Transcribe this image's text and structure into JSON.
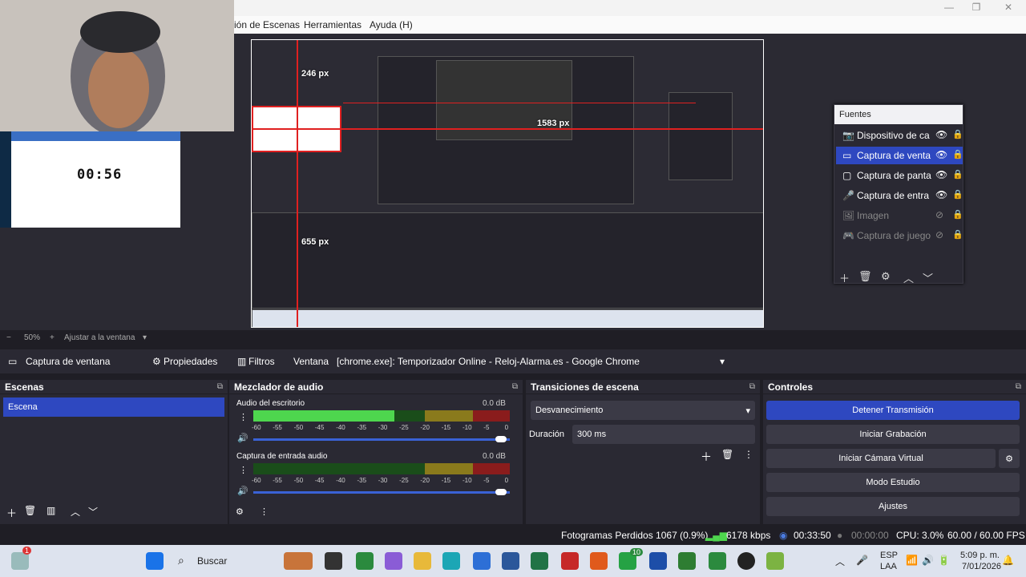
{
  "window": {
    "minimize": "—",
    "maximize": "❐",
    "close": "✕"
  },
  "menu": [
    "ión de Escenas",
    "Herramientas",
    "Ayuda (H)"
  ],
  "preview": {
    "px_246": "246 px",
    "px_1583": "1583 px",
    "px_655": "655 px",
    "timer": "00:56"
  },
  "sources": {
    "title": "Fuentes",
    "items": [
      {
        "label": "Dispositivo de ca",
        "icon": "camera-icon",
        "visible": true
      },
      {
        "label": "Captura de venta",
        "icon": "window-icon",
        "visible": true,
        "selected": true
      },
      {
        "label": "Captura de panta",
        "icon": "monitor-icon",
        "visible": true
      },
      {
        "label": "Captura de entra",
        "icon": "microphone-icon",
        "visible": true
      },
      {
        "label": "Imagen",
        "icon": "image-icon",
        "visible": false
      },
      {
        "label": "Captura de juego",
        "icon": "gamepad-icon",
        "visible": false
      }
    ]
  },
  "zoom": {
    "minus": "−",
    "value": "50%",
    "plus": "+",
    "fit": "Ajustar a la ventana"
  },
  "source_bar": {
    "name": "Captura de ventana",
    "props": "Propiedades",
    "filters": "Filtros",
    "window_label": "Ventana",
    "window_value": "[chrome.exe]: Temporizador Online - Reloj-Alarma.es - Google Chrome"
  },
  "scenes": {
    "title": "Escenas",
    "items": [
      "Escena"
    ]
  },
  "mixer": {
    "title": "Mezclador de audio",
    "channels": [
      {
        "name": "Audio del escritorio",
        "db": "0.0 dB",
        "level": 0.55,
        "peak": 0.98
      },
      {
        "name": "Captura de entrada audio",
        "db": "0.0 dB",
        "level": 0.0,
        "peak": 0.85
      }
    ],
    "ticks": [
      "-60",
      "-55",
      "-50",
      "-45",
      "-40",
      "-35",
      "-30",
      "-25",
      "-20",
      "-15",
      "-10",
      "-5",
      "0"
    ]
  },
  "transitions": {
    "title": "Transiciones de escena",
    "type": "Desvanecimiento",
    "duration_label": "Duración",
    "duration_value": "300 ms"
  },
  "controls": {
    "title": "Controles",
    "buttons": [
      "Detener Transmisión",
      "Iniciar Grabación",
      "Iniciar Cámara Virtual",
      "Modo Estudio",
      "Ajustes"
    ]
  },
  "status": {
    "frames": "Fotogramas Perdidos 1067 (0.9%)",
    "kbps": "6178 kbps",
    "live": "00:33:50",
    "rec": "00:00:00",
    "cpu": "CPU: 3.0%",
    "fps": "60.00 / 60.00 FPS"
  },
  "taskbar": {
    "search": "Buscar",
    "lang1": "ESP",
    "lang2": "LAA",
    "time": "5:09 p. m.",
    "date": "7/01/2026",
    "badge1": "1",
    "badge2": "10"
  },
  "colors": {
    "accent": "#2e48c0",
    "selection": "#e02020"
  }
}
